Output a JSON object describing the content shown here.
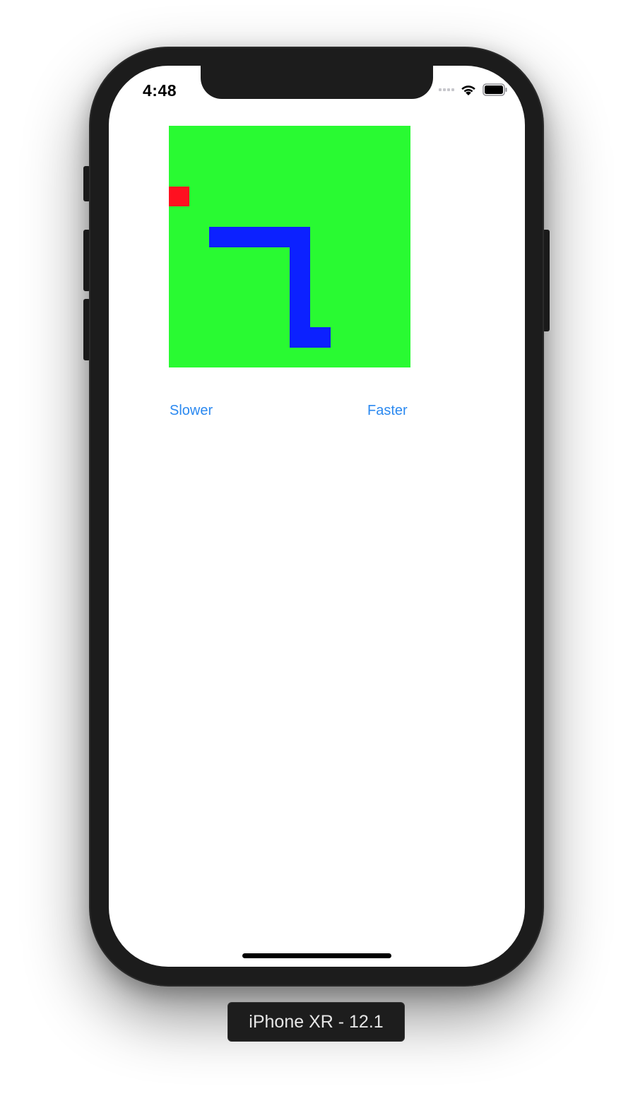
{
  "status_bar": {
    "time": "4:48"
  },
  "game": {
    "board_color": "#29fa32",
    "food_color": "#ff1020",
    "snake_color": "#0c21ff",
    "grid_size": 12,
    "food": [
      0,
      3
    ],
    "snake": [
      [
        2,
        5
      ],
      [
        3,
        5
      ],
      [
        4,
        5
      ],
      [
        5,
        5
      ],
      [
        6,
        5
      ],
      [
        6,
        6
      ],
      [
        6,
        7
      ],
      [
        6,
        8
      ],
      [
        6,
        9
      ],
      [
        6,
        10
      ],
      [
        7,
        10
      ]
    ]
  },
  "controls": {
    "slower_label": "Slower",
    "faster_label": "Faster",
    "accent_color": "#2b89f0"
  },
  "device": {
    "label": "iPhone XR - 12.1"
  }
}
